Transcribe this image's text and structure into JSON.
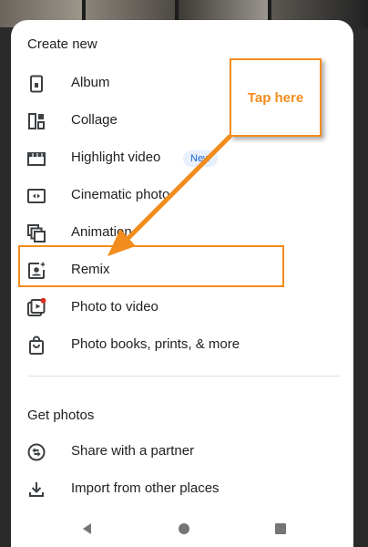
{
  "create_new": {
    "title": "Create new",
    "items": [
      {
        "label": "Album",
        "icon": "album-icon"
      },
      {
        "label": "Collage",
        "icon": "collage-icon"
      },
      {
        "label": "Highlight video",
        "icon": "highlight-video-icon",
        "badge": "New"
      },
      {
        "label": "Cinematic photo",
        "icon": "cinematic-photo-icon"
      },
      {
        "label": "Animation",
        "icon": "animation-icon"
      },
      {
        "label": "Remix",
        "icon": "remix-icon"
      },
      {
        "label": "Photo to video",
        "icon": "photo-to-video-icon"
      },
      {
        "label": "Photo books, prints, & more",
        "icon": "shopping-bag-icon"
      }
    ]
  },
  "get_photos": {
    "title": "Get photos",
    "items": [
      {
        "label": "Share with a partner",
        "icon": "partner-sharing-icon"
      },
      {
        "label": "Import from other places",
        "icon": "download-icon"
      }
    ]
  },
  "annotation": {
    "callout_text": "Tap here",
    "color": "#f28c1c"
  },
  "nav": [
    "back-icon",
    "home-icon",
    "recents-icon"
  ],
  "colors": {
    "sheet": "#ffffff",
    "text": "#202124",
    "icon": "#3c4043",
    "badge_bg": "#e8f0fe",
    "badge_text": "#1967d2",
    "notification_dot": "#d93025"
  }
}
